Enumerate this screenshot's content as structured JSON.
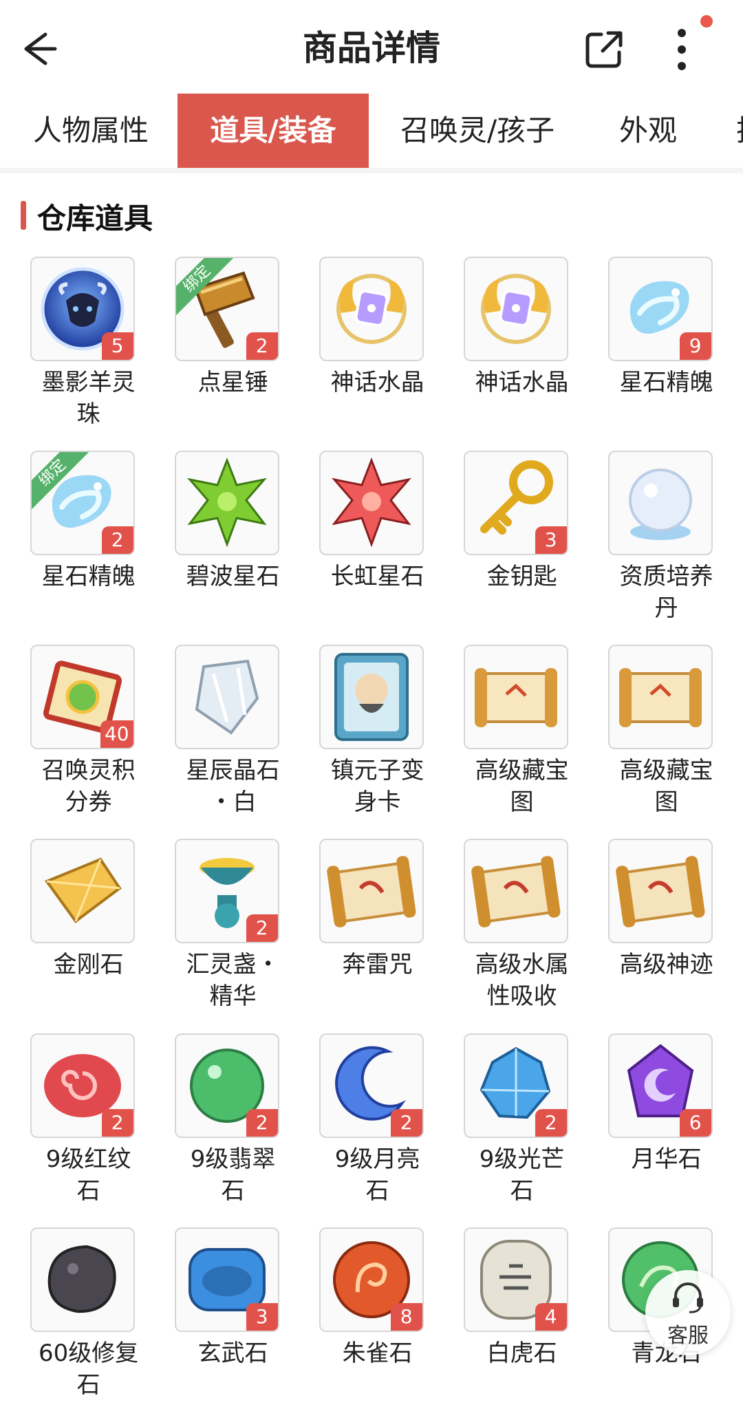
{
  "header": {
    "title": "商品详情"
  },
  "tabs": [
    {
      "label": "人物属性",
      "active": false
    },
    {
      "label": "道具/装备",
      "active": true
    },
    {
      "label": "召唤灵/孩子",
      "active": false
    },
    {
      "label": "外观",
      "active": false
    },
    {
      "label": "技",
      "active": false
    }
  ],
  "section": {
    "title": "仓库道具"
  },
  "bind_tag": "绑定",
  "items": [
    {
      "name": "墨影羊灵\n珠",
      "count": "5",
      "icon": "dark-ram-orb"
    },
    {
      "name": "点星锤",
      "count": "2",
      "icon": "hammer",
      "bound": true
    },
    {
      "name": "神话水晶",
      "count": "",
      "icon": "myth-crystal"
    },
    {
      "name": "神话水晶",
      "count": "",
      "icon": "myth-crystal"
    },
    {
      "name": "星石精魄",
      "count": "9",
      "icon": "water-swirl"
    },
    {
      "name": "星石精魄",
      "count": "2",
      "icon": "water-swirl",
      "bound": true
    },
    {
      "name": "碧波星石",
      "count": "",
      "icon": "green-star"
    },
    {
      "name": "长虹星石",
      "count": "",
      "icon": "red-star"
    },
    {
      "name": "金钥匙",
      "count": "3",
      "icon": "gold-key"
    },
    {
      "name": "资质培养\n丹",
      "count": "",
      "icon": "snow-orb"
    },
    {
      "name": "召唤灵积\n分券",
      "count": "40",
      "icon": "summon-ticket"
    },
    {
      "name": "星辰晶石\n・白",
      "count": "",
      "icon": "white-crystal"
    },
    {
      "name": "镇元子变\n身卡",
      "count": "",
      "icon": "transform-card"
    },
    {
      "name": "高级藏宝\n图",
      "count": "",
      "icon": "treasure-map"
    },
    {
      "name": "高级藏宝\n图",
      "count": "",
      "icon": "treasure-map"
    },
    {
      "name": "金刚石",
      "count": "",
      "icon": "diamond-gold"
    },
    {
      "name": "汇灵盏・\n精华",
      "count": "2",
      "icon": "spirit-lamp"
    },
    {
      "name": "奔雷咒",
      "count": "",
      "icon": "scroll"
    },
    {
      "name": "高级水属\n性吸收",
      "count": "",
      "icon": "scroll"
    },
    {
      "name": "高级神迹",
      "count": "",
      "icon": "scroll"
    },
    {
      "name": "9级红纹\n石",
      "count": "2",
      "icon": "red-stone"
    },
    {
      "name": "9级翡翠\n石",
      "count": "2",
      "icon": "green-stone"
    },
    {
      "name": "9级月亮\n石",
      "count": "2",
      "icon": "moon-stone"
    },
    {
      "name": "9级光芒\n石",
      "count": "2",
      "icon": "light-stone"
    },
    {
      "name": "月华石",
      "count": "6",
      "icon": "purple-moon-stone"
    },
    {
      "name": "60级修复\n石",
      "count": "",
      "icon": "repair-stone"
    },
    {
      "name": "玄武石",
      "count": "3",
      "icon": "xuanwu-stone"
    },
    {
      "name": "朱雀石",
      "count": "8",
      "icon": "zhuque-stone"
    },
    {
      "name": "白虎石",
      "count": "4",
      "icon": "baihu-stone"
    },
    {
      "name": "青龙石",
      "count": "",
      "icon": "qinglong-stone"
    }
  ],
  "customer_service": {
    "label": "客服"
  },
  "colors": {
    "accent": "#d9574d",
    "badge": "#e1524a",
    "bound": "#56b26a"
  }
}
